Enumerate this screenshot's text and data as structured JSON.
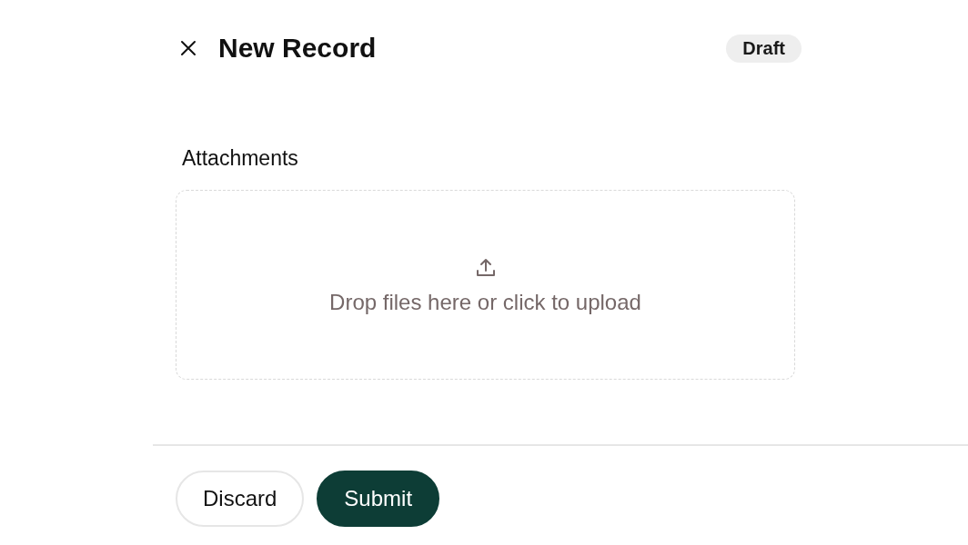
{
  "header": {
    "title": "New Record",
    "status_badge": "Draft"
  },
  "attachments": {
    "label": "Attachments",
    "dropzone_text": "Drop files here or click to upload"
  },
  "footer": {
    "buttons": [
      {
        "label": "Discard",
        "kind": "secondary"
      },
      {
        "label": "Submit",
        "kind": "primary"
      }
    ]
  }
}
